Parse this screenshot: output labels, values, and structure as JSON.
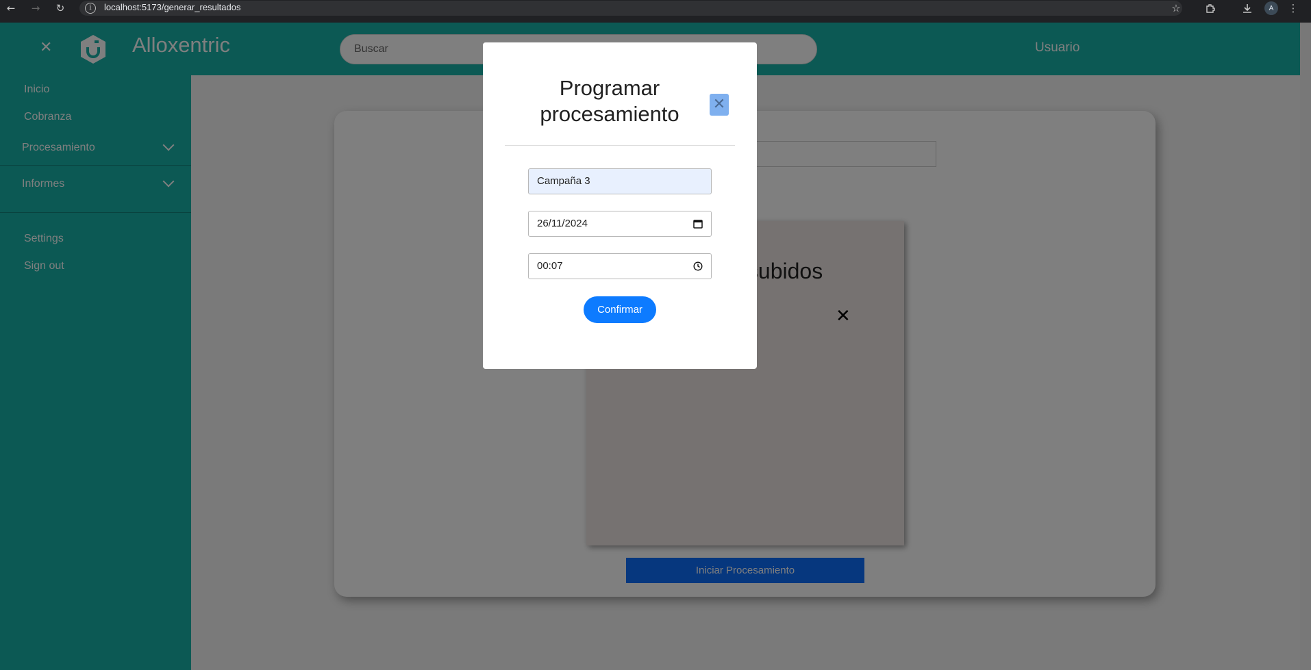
{
  "browser": {
    "url": "localhost:5173/generar_resultados",
    "profile_initial": "A"
  },
  "header": {
    "brand": "Alloxentric",
    "search_placeholder": "Buscar",
    "user_label": "Usuario"
  },
  "sidebar": {
    "items": [
      {
        "label": "Inicio"
      },
      {
        "label": "Cobranza"
      },
      {
        "label": "Procesamiento"
      },
      {
        "label": "Informes"
      },
      {
        "label": "Settings"
      },
      {
        "label": "Sign out"
      }
    ]
  },
  "main": {
    "panel_title_partial": "s subidos",
    "start_button": "Iniciar Procesamiento"
  },
  "modal": {
    "title": "Programar procesamiento",
    "campaign_value": "Campaña 3",
    "date_value": "26/11/2024",
    "time_value": "00:07",
    "confirm_label": "Confirmar"
  },
  "colors": {
    "accent_teal": "#19b3a8",
    "primary_blue": "#0d6efd"
  }
}
